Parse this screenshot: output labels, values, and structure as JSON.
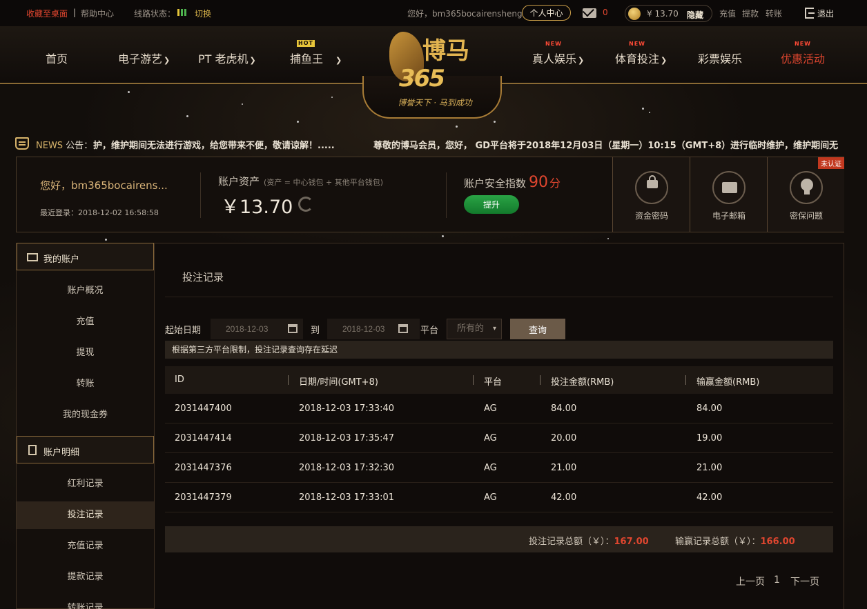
{
  "topbar": {
    "bookmark": "收藏至桌面",
    "separator": "|",
    "help": "帮助中心",
    "line_status_label": "线路状态：",
    "switch": "切换",
    "greeting": "您好，bm365bocairensheng",
    "personal_center": "个人中心",
    "mail_count": "0",
    "balance": "¥ 13.70",
    "hide": "隐藏",
    "recharge": "充值",
    "withdraw": "提款",
    "transfer": "转账",
    "logout": "退出"
  },
  "nav": {
    "home": "首页",
    "egames": "电子游艺",
    "pt": "PT 老虎机",
    "fishing": "捕鱼王",
    "fishing_badge": "HOT",
    "live": "真人娱乐",
    "live_badge": "NEW",
    "sports": "体育投注",
    "sports_badge": "NEW",
    "lottery": "彩票娱乐",
    "promo": "优惠活动",
    "promo_badge": "NEW"
  },
  "logo": {
    "zh": "博马",
    "num": "365",
    "slogan": "博誉天下 · 马到成功"
  },
  "news": {
    "label": "NEWS",
    "label_suffix": "公告：",
    "text1": "护，维护期间无法进行游戏，给您带来不便，敬请谅解！.....",
    "text2": "尊敬的博马会员，您好， GD平台将于2018年12月03日（星期一）10:15（GMT+8）进行临时维护，维护期间无"
  },
  "account": {
    "greeting": "您好，bm365bocairens...",
    "last_login": "最近登录：2018-12-02 16:58:58",
    "assets_title": "账户资产",
    "assets_note": "(资产 = 中心钱包 + 其他平台钱包)",
    "assets_value": "￥13.70",
    "safety_title": "账户安全指数",
    "safety_score": "90",
    "safety_unit": "分",
    "upgrade": "提升",
    "fund_password": "资金密码",
    "email": "电子邮箱",
    "security_question": "密保问题",
    "unverified": "未认证"
  },
  "sidebar": {
    "my_account": "我的账户",
    "items_account": [
      "账户概况",
      "充值",
      "提现",
      "转账",
      "我的现金券"
    ],
    "account_detail": "账户明细",
    "items_detail": [
      "红利记录",
      "投注记录",
      "充值记录",
      "提款记录",
      "转账记录"
    ]
  },
  "main": {
    "title": "投注记录",
    "start_date_label": "起始日期",
    "start_date": "2018-12-03",
    "to_label": "到",
    "end_date": "2018-12-03",
    "platform_label": "平台",
    "platform_value": "所有的",
    "query": "查询",
    "notice": "根据第三方平台限制，投注记录查询存在延迟",
    "columns": [
      "ID",
      "日期/时间(GMT+8)",
      "平台",
      "投注金额(RMB)",
      "输赢金额(RMB)"
    ],
    "rows": [
      [
        "2031447400",
        "2018-12-03 17:33:40",
        "AG",
        "84.00",
        "84.00"
      ],
      [
        "2031447414",
        "2018-12-03 17:35:47",
        "AG",
        "20.00",
        "19.00"
      ],
      [
        "2031447376",
        "2018-12-03 17:32:30",
        "AG",
        "21.00",
        "21.00"
      ],
      [
        "2031447379",
        "2018-12-03 17:33:01",
        "AG",
        "42.00",
        "42.00"
      ]
    ],
    "bet_total_label": "投注记录总额（￥）：",
    "bet_total": "167.00",
    "win_total_label": "输赢记录总额（￥）：",
    "win_total": "166.00",
    "prev": "上一页",
    "page": "1",
    "next": "下一页"
  },
  "colors": {
    "accent_red": "#e0462f",
    "accent_gold": "#d9b44a",
    "button_green": "#2aa345",
    "signal": [
      "#e6c63a",
      "#4eb34e",
      "#4eb34e"
    ]
  }
}
